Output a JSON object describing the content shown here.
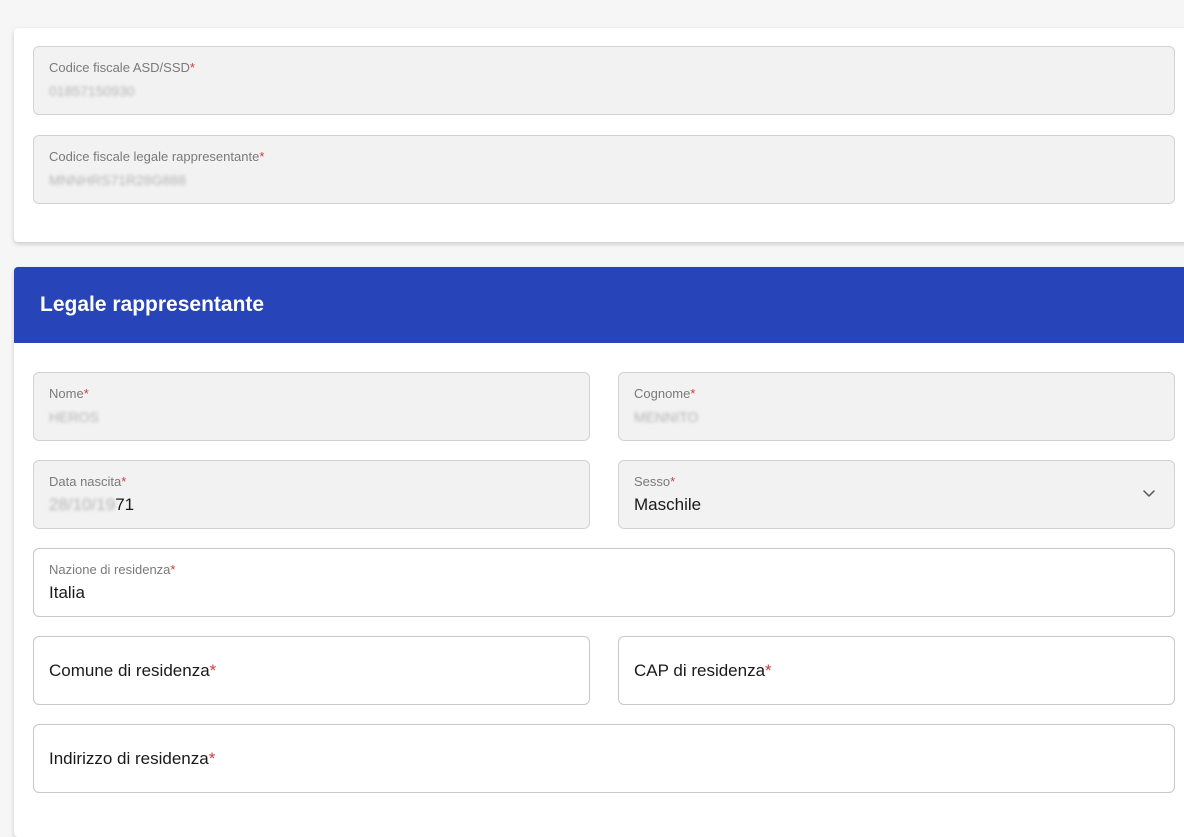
{
  "top": {
    "cf_asd": {
      "label": "Codice fiscale ASD/SSD",
      "value": "01857150930"
    },
    "cf_legale": {
      "label": "Codice fiscale legale rappresentante",
      "value": "MNNHRS71R28G888"
    }
  },
  "section": {
    "title": "Legale rappresentante",
    "header_color": "#2744b8"
  },
  "form": {
    "nome": {
      "label": "Nome",
      "value": "HEROS"
    },
    "cognome": {
      "label": "Cognome",
      "value": "MENNITO"
    },
    "data_nascita": {
      "label": "Data nascita",
      "value_hidden": "28/10/19",
      "value_visible": "71"
    },
    "sesso": {
      "label": "Sesso",
      "value": "Maschile",
      "icon": "chevron-down-icon"
    },
    "nazione": {
      "label": "Nazione di residenza",
      "value": "Italia"
    },
    "comune": {
      "placeholder": "Comune di residenza"
    },
    "cap": {
      "placeholder": "CAP di residenza"
    },
    "indirizzo": {
      "placeholder": "Indirizzo di residenza"
    },
    "required_mark": "*"
  }
}
